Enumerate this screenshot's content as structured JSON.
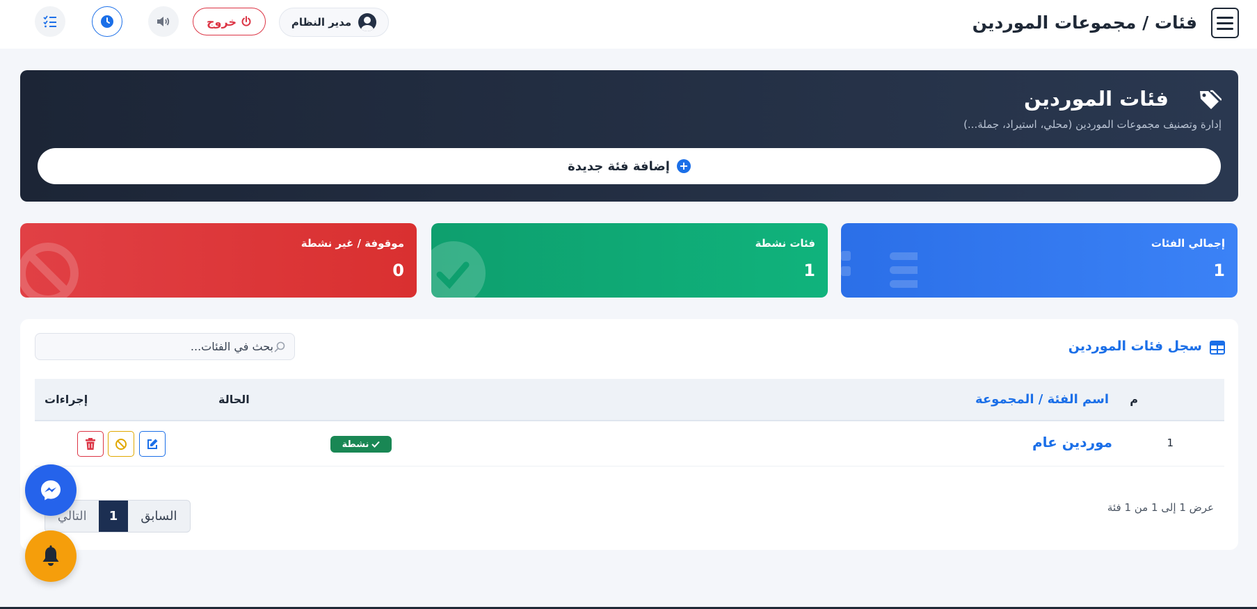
{
  "header": {
    "page_title": "فئات / مجموعات الموردين",
    "user_label": "مدير النظام",
    "logout_label": "خروج"
  },
  "hero": {
    "title": "فئات الموردين",
    "subtitle": "إدارة وتصنيف مجموعات الموردين (محلي، استيراد، جملة...)",
    "add_label": "إضافة فئة جديدة"
  },
  "stats": {
    "total": {
      "label": "إجمالي الفئات",
      "value": "1"
    },
    "active": {
      "label": "فئات نشطة",
      "value": "1"
    },
    "stopped": {
      "label": "موقوفة / غير نشطة",
      "value": "0"
    }
  },
  "table_card": {
    "title": "سجل فئات الموردين",
    "search_placeholder": "بحث في الفئات...",
    "columns": {
      "num": "م",
      "name": "اسم الفئة / المجموعة",
      "status": "الحالة",
      "actions": "إجراءات"
    },
    "rows": [
      {
        "num": "1",
        "name": "موردين عام",
        "status": "نشطة"
      }
    ],
    "info": "عرض 1 إلى 1 من 1 فئة",
    "pagination": {
      "prev": "السابق",
      "current": "1",
      "next": "التالي"
    }
  },
  "colors": {
    "primary": "#1b6fe8",
    "hero_bg": "#1c2536",
    "total_card": "#2b6fe8",
    "active_card": "#0e9f6e",
    "stopped_card": "#e14045",
    "badge_active": "#198754",
    "messenger": "#2563eb",
    "bell": "#f59e0b"
  },
  "icons": {
    "menu": "hamburger-menu-icon",
    "user": "user-circle-icon",
    "logout": "power-icon",
    "sound": "speaker-icon",
    "clock": "clock-icon",
    "tasks": "list-check-icon",
    "hero": "tags-icon",
    "add": "plus-circle-icon",
    "table": "table-icon",
    "search": "search-icon",
    "edit": "edit-icon",
    "block": "ban-icon",
    "delete": "trash-icon",
    "messenger": "messenger-icon",
    "bell": "bell-icon"
  }
}
